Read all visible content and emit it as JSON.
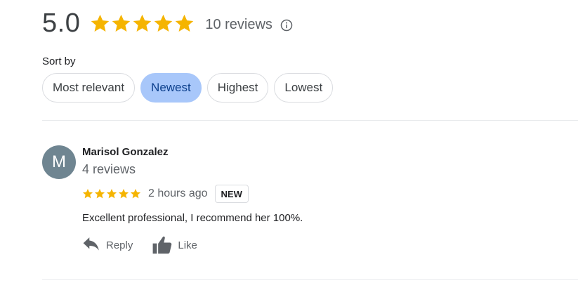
{
  "summary": {
    "rating": "5.0",
    "stars": 5,
    "review_count": "10 reviews",
    "info_icon": "info-icon"
  },
  "sort": {
    "label": "Sort by",
    "options": [
      "Most relevant",
      "Newest",
      "Highest",
      "Lowest"
    ],
    "selected": "Newest"
  },
  "review": {
    "avatar_letter": "M",
    "avatar_color": "#6f8591",
    "name": "Marisol Gonzalez",
    "reviewer_reviews": "4 reviews",
    "stars": 5,
    "time": "2 hours ago",
    "badge": "NEW",
    "text": "Excellent professional, I recommend her 100%.",
    "actions": {
      "reply_label": "Reply",
      "reply_icon": "reply-icon",
      "like_label": "Like",
      "like_icon": "thumbs-up-icon"
    }
  },
  "colors": {
    "star": "#f5b400",
    "selected_chip_bg": "#a8c7fa",
    "selected_chip_text": "#0b3f8c"
  }
}
